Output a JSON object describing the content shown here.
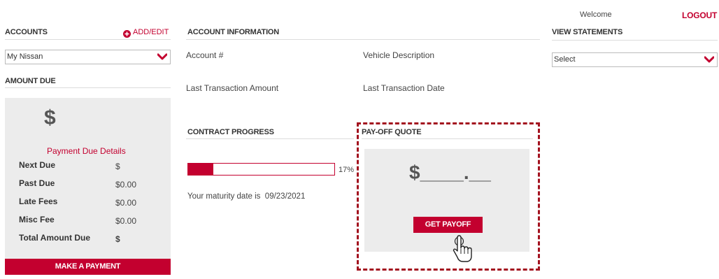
{
  "header": {
    "welcome": "Welcome",
    "logout": "LOGOUT"
  },
  "accounts": {
    "title": "ACCOUNTS",
    "add_edit": "ADD/EDIT",
    "selected": "My Nissan"
  },
  "amount_due": {
    "title": "AMOUNT DUE",
    "currency_symbol": "$",
    "details_title": "Payment Due Details",
    "rows": [
      {
        "label": "Next Due",
        "value": "$"
      },
      {
        "label": "Past Due",
        "value": "$0.00"
      },
      {
        "label": "Late Fees",
        "value": "$0.00"
      },
      {
        "label": "Misc Fee",
        "value": "$0.00"
      },
      {
        "label": "Total Amount Due",
        "value": "$"
      }
    ],
    "pay_button": "MAKE A PAYMENT"
  },
  "account_info": {
    "title": "ACCOUNT INFORMATION",
    "account_number_label": "Account #",
    "vehicle_label": "Vehicle Description",
    "last_amount_label": "Last Transaction Amount",
    "last_date_label": "Last Transaction Date"
  },
  "contract_progress": {
    "title": "CONTRACT PROGRESS",
    "progress": 0.17,
    "progress_label": "17%",
    "maturity_text": "Your maturity date is  09/23/2021"
  },
  "payoff": {
    "title": "PAY-OFF QUOTE",
    "amount_placeholder": "$____.__",
    "button": "GET PAYOFF"
  },
  "statements": {
    "title": "VIEW STATEMENTS",
    "selected": "Select"
  },
  "colors": {
    "accent": "#c3002f",
    "panel": "#ececec",
    "highlight_border": "#a3121f"
  },
  "icons": [
    "plus-circle-icon",
    "chevron-down-icon",
    "hand-cursor-icon"
  ]
}
